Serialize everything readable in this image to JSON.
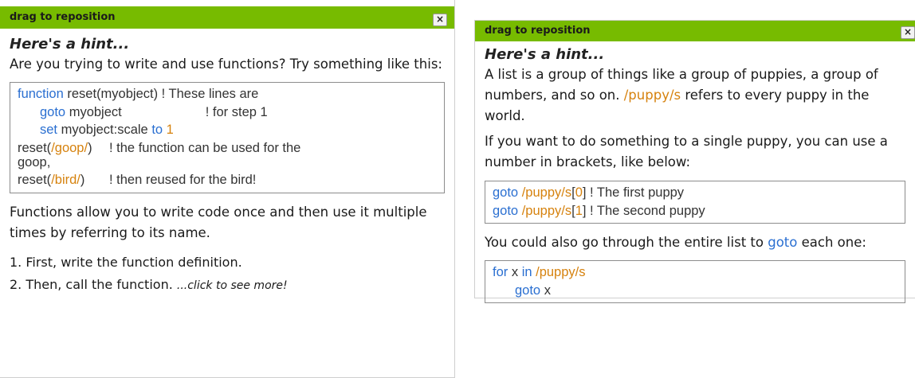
{
  "panel1": {
    "title": "drag to reposition",
    "close": "×",
    "hint_title": "Here's a hint...",
    "intro": "Are you trying to write and use functions? Try something like this:",
    "code": {
      "l1_kw": "function",
      "l1_rest": " reset(myobject)",
      "l1_cmt": " ! These lines are",
      "l2_kw": "goto",
      "l2_rest": " myobject",
      "l2_cmt": "! for step 1",
      "l3_kw": "set",
      "l3_rest": " myobject:scale ",
      "l3_kw2": "to",
      "l3_num": "1",
      "l4_pre": "reset(",
      "l4_path": "/goop/",
      "l4_post": ")",
      "l4_cmt1": "! the function can be used for the",
      "l4_cmt2": "goop,",
      "l5_pre": "reset(",
      "l5_path": "/bird/",
      "l5_post": ")",
      "l5_cmt": "! then reused for the bird!"
    },
    "explain": "Functions allow you to write code once and then use it multiple times by referring to its name.",
    "steps": [
      "1. First, write the function definition.",
      "2. Then, call the function. "
    ],
    "more": "...click to see more!"
  },
  "panel2": {
    "title": "drag to reposition",
    "close": "×",
    "hint_title": "Here's a hint...",
    "p1_a": "A list is a group of things like a group of puppies, a group of numbers, and so on. ",
    "p1_path": "/puppy/s",
    "p1_b": " refers to every puppy in the world.",
    "p2": "If you want to do something to a single puppy, you can use a number in brackets, like below:",
    "code1": {
      "l1_kw": "goto",
      "l1_path": " /puppy/s",
      "l1_idx_open": "[",
      "l1_idx": "0",
      "l1_idx_close": "]",
      "l1_cmt": " ! The first puppy",
      "l2_kw": "goto",
      "l2_path": " /puppy/s",
      "l2_idx_open": "[",
      "l2_idx": "1",
      "l2_idx_close": "]",
      "l2_cmt": " ! The second puppy"
    },
    "p3_a": "You could also go through the entire list to ",
    "p3_kw": "goto",
    "p3_b": " each one:",
    "code2": {
      "l1_kw": "for",
      "l1_var": " x ",
      "l1_kw2": "in",
      "l1_path": " /puppy/s",
      "l2_kw": "goto",
      "l2_var": " x"
    }
  },
  "colors": {
    "titlebar": "#77bb00",
    "keyword": "#2a6fd1",
    "path": "#d6820e"
  }
}
